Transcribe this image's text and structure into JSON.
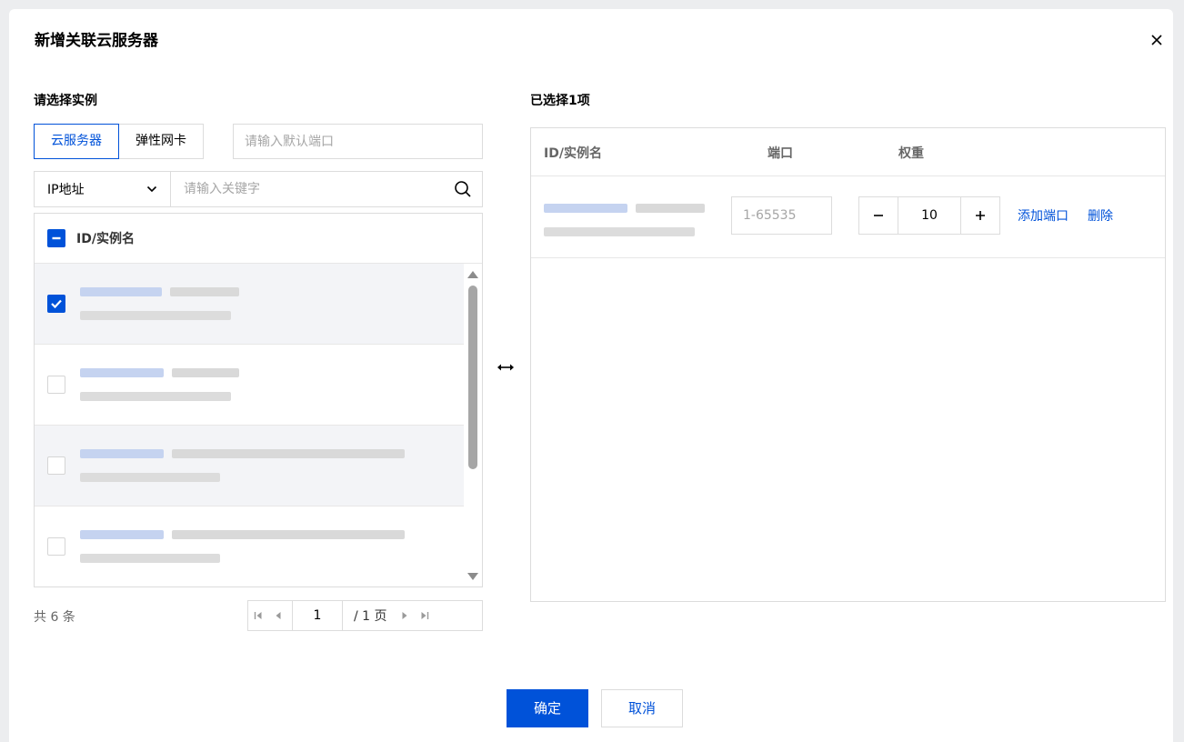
{
  "dialog": {
    "title": "新增关联云服务器",
    "close_icon": "close-icon"
  },
  "left": {
    "section_title": "请选择实例",
    "tabs": [
      {
        "label": "云服务器",
        "active": true
      },
      {
        "label": "弹性网卡",
        "active": false
      }
    ],
    "port_placeholder": "请输入默认端口",
    "filter": {
      "selected": "IP地址",
      "keyword_placeholder": "请输入关键字"
    },
    "list_header": "ID/实例名",
    "rows": [
      {
        "checked": true
      },
      {
        "checked": false
      },
      {
        "checked": false
      },
      {
        "checked": false
      }
    ],
    "total": "共 6 条",
    "pager": {
      "page": "1",
      "total_pages": "/ 1 页"
    }
  },
  "right": {
    "section_title": "已选择1项",
    "headers": {
      "id": "ID/实例名",
      "port": "端口",
      "weight": "权重"
    },
    "row": {
      "port_placeholder": "1-65535",
      "weight": "10",
      "add_port": "添加端口",
      "delete": "删除"
    }
  },
  "footer": {
    "confirm": "确定",
    "cancel": "取消"
  },
  "colors": {
    "primary": "#0052d9",
    "border": "#dcdcdc",
    "row_bg": "#f3f4f7"
  }
}
